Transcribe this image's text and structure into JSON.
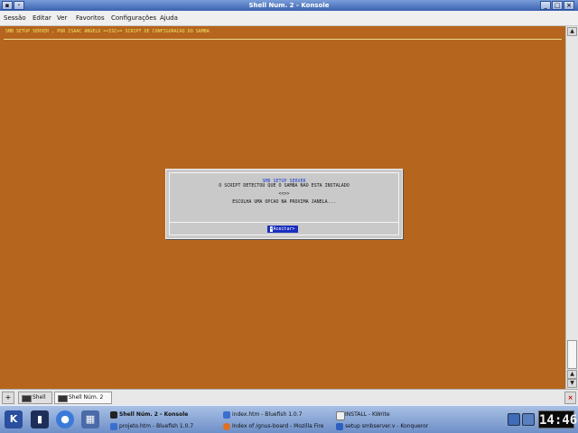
{
  "window": {
    "title": "Shell Num. 2 - Konsole"
  },
  "menu": [
    "Sessão",
    "Editar",
    "Ver",
    "Favoritos",
    "Configurações",
    "Ajuda"
  ],
  "terminal": {
    "header": "SMB SETUP SERVER , POR ISAAC ANGELO =<ISC>= SCRIPT DE CONFIGURACAO DO SAMBA",
    "dialog": {
      "title": "SMB SETUP SERVER",
      "line1": "O SCRIPT DETECTOU QUE O SAMBA NAO ESTA INSTALADO",
      "line2": "<<>>",
      "line3": "ESCOLHA UMA OPCAO NA PROXIMA JANELA...",
      "button_cursor": "<",
      "button_rest": "Aceitar>"
    }
  },
  "tabs": [
    {
      "label": "Shell"
    },
    {
      "label": "Shell Núm. 2"
    }
  ],
  "taskbar": {
    "tasks": [
      {
        "label": "Shell Núm. 2 - Konsole"
      },
      {
        "label": "projeto.htm - Bluefish 1.0.7"
      },
      {
        "label": "index.htm - Bluefish 1.0.7"
      },
      {
        "label": "Index of /gnus-board - Mozilla Fire"
      },
      {
        "label": "INSTALL - KWrite"
      },
      {
        "label": "setup smbserver.v - Konqueror"
      }
    ],
    "clock": "14:46"
  },
  "colors": {
    "terminal_bg": "#b5651d",
    "header_text": "#f0e060",
    "dialog_bg": "#c9c9c9",
    "button_bg": "#1a2fbf",
    "titlebar": "#3b62b0"
  }
}
